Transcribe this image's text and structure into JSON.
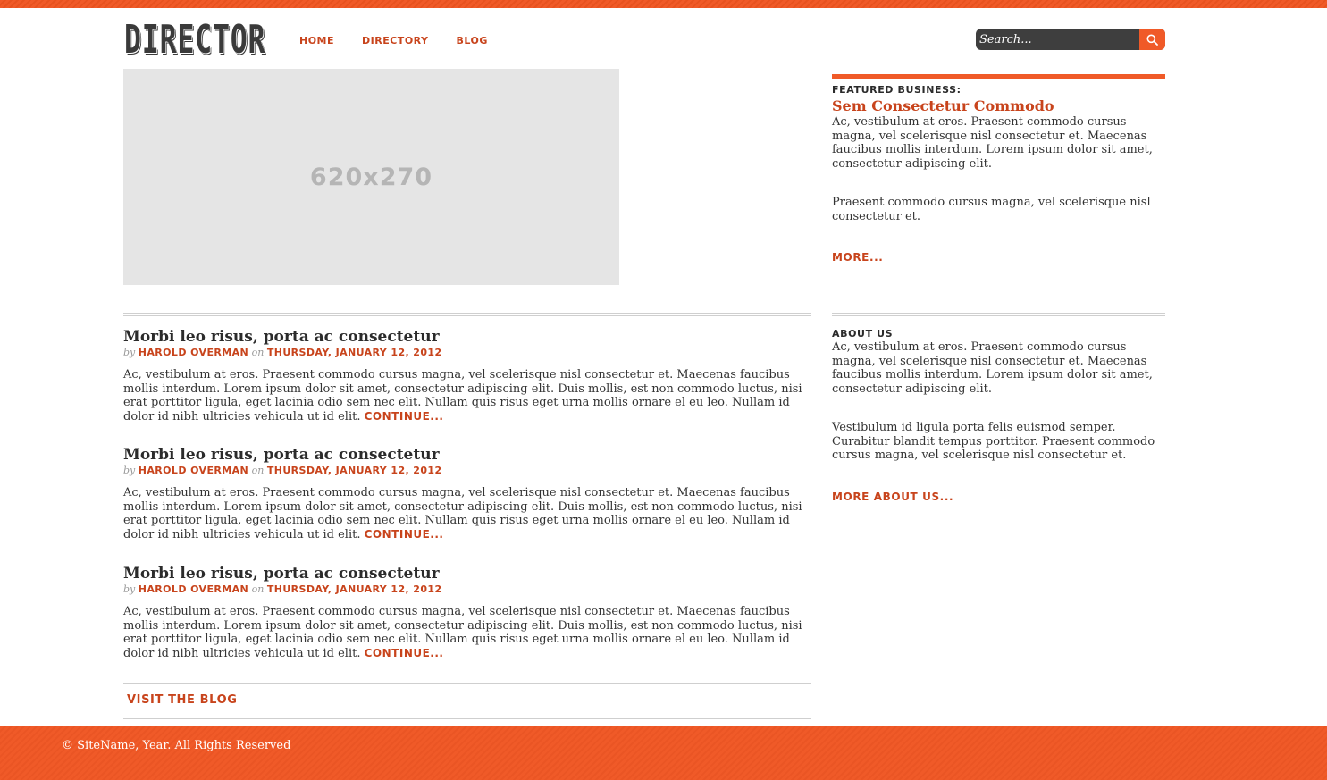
{
  "header": {
    "logo_text": "DIRECTOR",
    "nav": [
      "HOME",
      "DIRECTORY",
      "BLOG"
    ],
    "search_placeholder": "Search..."
  },
  "hero": {
    "placeholder_label": "620x270"
  },
  "featured": {
    "label": "FEATURED BUSINESS:",
    "name": "Sem Consectetur Commodo",
    "paragraph1": "Ac, vestibulum at eros. Praesent commodo cursus magna, vel scelerisque nisl consectetur et. Maecenas faucibus mollis interdum. Lorem ipsum dolor sit amet, consectetur adipiscing elit.",
    "paragraph2": "Praesent commodo cursus magna, vel scelerisque nisl consectetur et.",
    "more_label": "MORE..."
  },
  "about": {
    "label": "ABOUT US",
    "paragraph1": "Ac, vestibulum at eros. Praesent commodo cursus magna, vel scelerisque nisl consectetur et. Maecenas faucibus mollis interdum. Lorem ipsum dolor sit amet, consectetur adipiscing elit.",
    "paragraph2": "Vestibulum id ligula porta felis euismod semper. Curabitur blandit tempus porttitor. Praesent commodo cursus magna, vel scelerisque nisl consectetur et.",
    "more_label": "MORE ABOUT US..."
  },
  "posts": [
    {
      "title": "Morbi leo risus, porta ac consectetur",
      "by": "by",
      "author": "HAROLD OVERMAN",
      "on": "on",
      "date": "THURSDAY, JANUARY 12, 2012",
      "excerpt": "Ac, vestibulum at eros. Praesent commodo cursus magna, vel scelerisque nisl consectetur et. Maecenas faucibus mollis interdum. Lorem ipsum dolor sit amet, consectetur adipiscing elit. Duis mollis, est non commodo luctus, nisi erat porttitor ligula, eget lacinia odio sem nec elit. Nullam quis risus eget urna mollis ornare el eu leo. Nullam id dolor id nibh ultricies vehicula ut id elit.",
      "continue": "CONTINUE..."
    },
    {
      "title": "Morbi leo risus, porta ac consectetur",
      "by": "by",
      "author": "HAROLD OVERMAN",
      "on": "on",
      "date": "THURSDAY, JANUARY 12, 2012",
      "excerpt": "Ac, vestibulum at eros. Praesent commodo cursus magna, vel scelerisque nisl consectetur et. Maecenas faucibus mollis interdum. Lorem ipsum dolor sit amet, consectetur adipiscing elit. Duis mollis, est non commodo luctus, nisi erat porttitor ligula, eget lacinia odio sem nec elit. Nullam quis risus eget urna mollis ornare el eu leo. Nullam id dolor id nibh ultricies vehicula ut id elit.",
      "continue": "CONTINUE..."
    },
    {
      "title": "Morbi leo risus, porta ac consectetur",
      "by": "by",
      "author": "HAROLD OVERMAN",
      "on": "on",
      "date": "THURSDAY, JANUARY 12, 2012",
      "excerpt": "Ac, vestibulum at eros. Praesent commodo cursus magna, vel scelerisque nisl consectetur et. Maecenas faucibus mollis interdum. Lorem ipsum dolor sit amet, consectetur adipiscing elit. Duis mollis, est non commodo luctus, nisi erat porttitor ligula, eget lacinia odio sem nec elit. Nullam quis risus eget urna mollis ornare el eu leo. Nullam id dolor id nibh ultricies vehicula ut id elit.",
      "continue": "CONTINUE..."
    }
  ],
  "blog_link": "VISIT THE BLOG",
  "footer": {
    "copyright": "© SiteName, Year. All Rights Reserved"
  },
  "colors": {
    "accent": "#f05a28",
    "link": "#c8441c",
    "search_bg": "#3e3e3e"
  },
  "icons": {
    "search_button": "search-icon"
  }
}
